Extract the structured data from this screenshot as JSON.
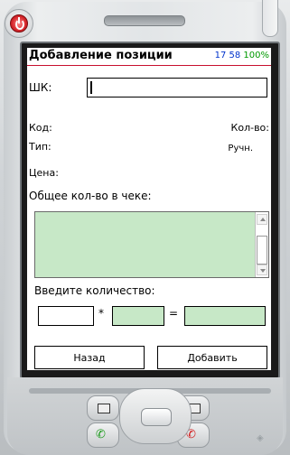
{
  "app": {
    "title": "Добавление позиции",
    "status_time": "17 58",
    "status_battery": "100%"
  },
  "form": {
    "barcode_label": "ШК:",
    "barcode_value": "",
    "code_label": "Код:",
    "qty_label": "Кол-во:",
    "type_label": "Тип:",
    "mode_value": "Ручн.",
    "price_label": "Цена:",
    "total_qty_label": "Общее кол-во в чеке:",
    "total_qty_value": "",
    "enter_qty_label": "Введите количество:",
    "multiply_sign": "*",
    "equals_sign": "=",
    "qty_input_value": "",
    "factor_value": "",
    "result_value": ""
  },
  "buttons": {
    "back_label": "Назад",
    "add_label": "Добавить"
  },
  "colors": {
    "accent_line": "#c8102e",
    "field_green": "#c7e8c7",
    "time_blue": "#0033cc",
    "battery_green": "#009900"
  },
  "hardware": {
    "icons": [
      "power-icon",
      "start-icon",
      "calendar-icon",
      "call-icon",
      "end-call-icon"
    ]
  }
}
